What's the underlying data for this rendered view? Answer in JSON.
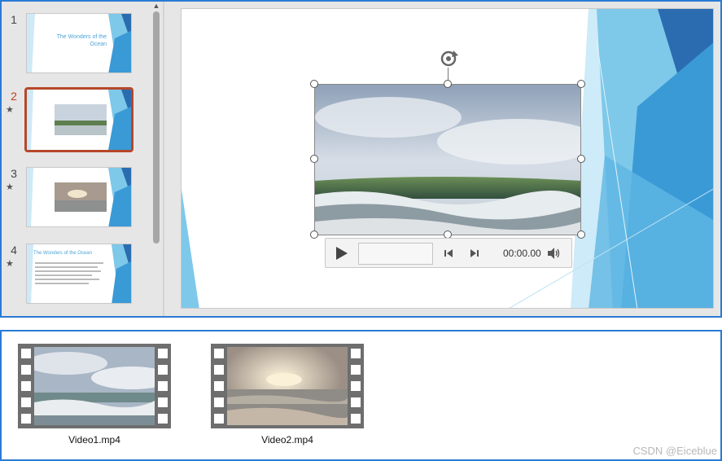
{
  "slides_pane": {
    "slides": [
      {
        "number": "1",
        "has_animation": false,
        "title": "The Wonders of the Ocean",
        "active": false
      },
      {
        "number": "2",
        "has_animation": true,
        "active": true
      },
      {
        "number": "3",
        "has_animation": true,
        "active": false
      },
      {
        "number": "4",
        "has_animation": true,
        "title": "The Wonders of the Ocean",
        "active": false
      }
    ],
    "animation_marker": "★"
  },
  "player": {
    "time": "00:00.00"
  },
  "files": [
    {
      "name": "Video1.mp4"
    },
    {
      "name": "Video2.mp4"
    }
  ],
  "watermark": "CSDN @Eiceblue",
  "colors": {
    "selection_border": "#b7472a",
    "active_number": "#c43e1c",
    "panel_border": "#2b7bd4",
    "theme_blue_dark": "#2b6cb0",
    "theme_blue_light": "#7ec8ea"
  }
}
